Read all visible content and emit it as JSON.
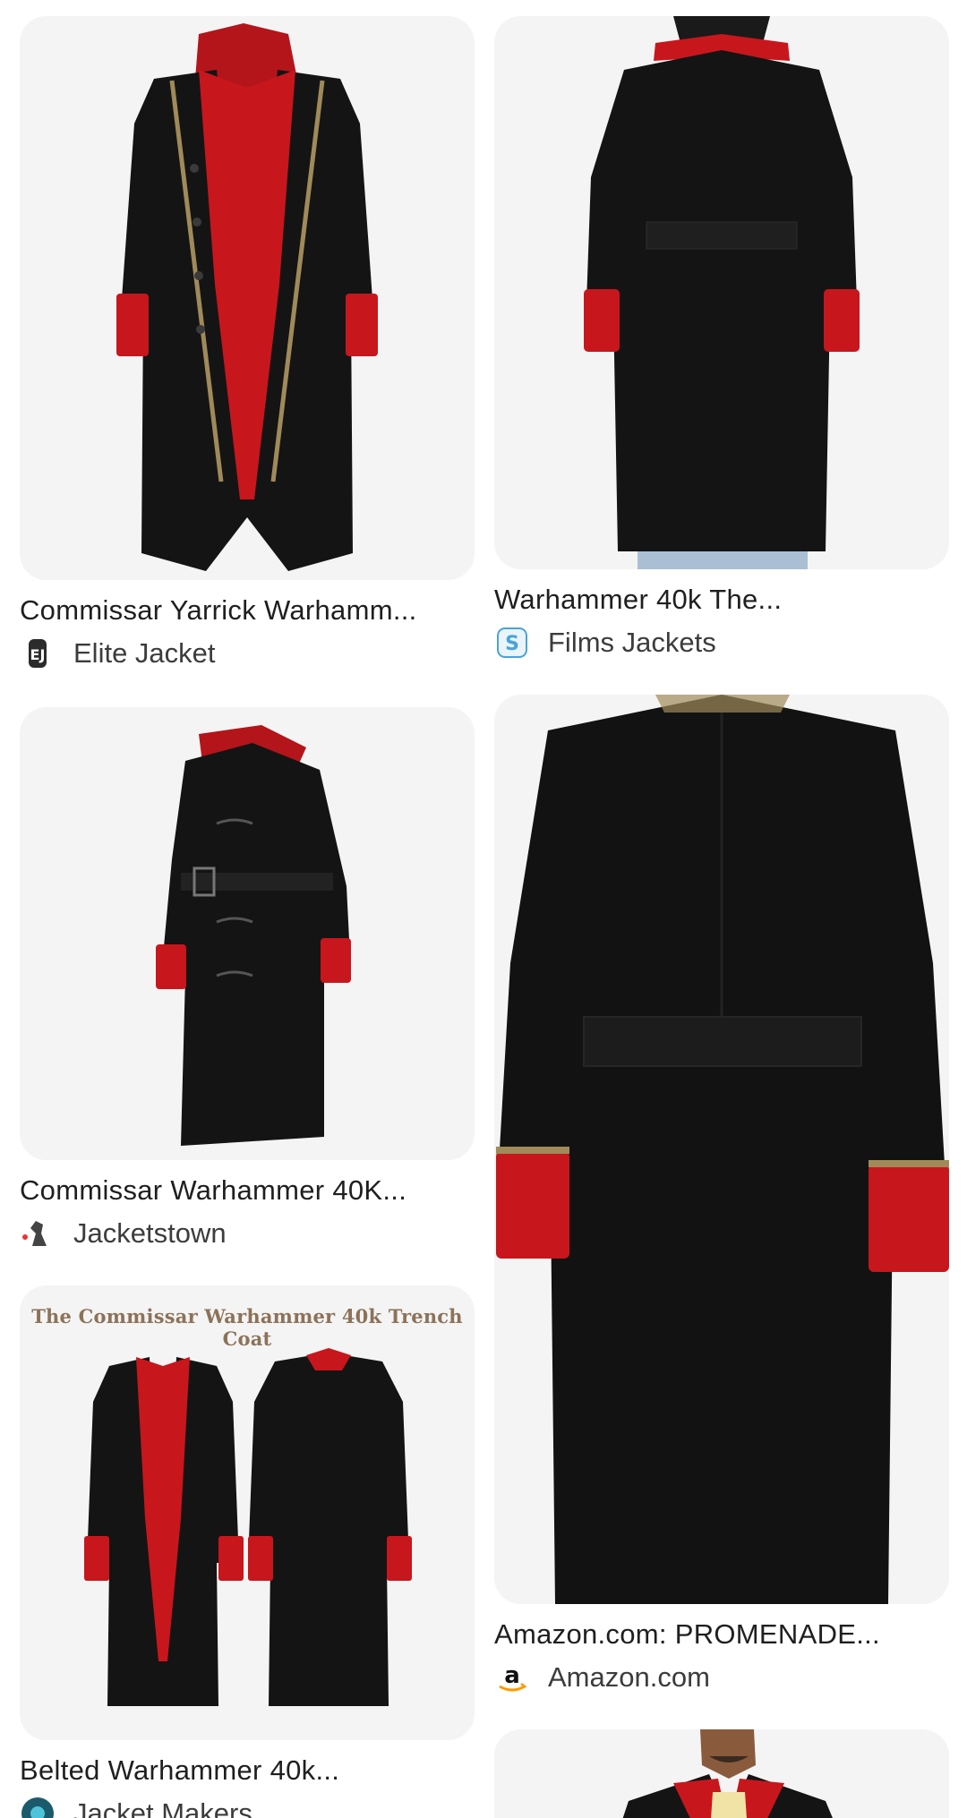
{
  "results": [
    {
      "title": "Commissar Yarrick Warhamm...",
      "source": "Elite Jacket",
      "image": "black-red-trench-coat-front"
    },
    {
      "title": "Warhammer 40k The...",
      "source": "Films Jackets",
      "image": "black-red-trench-coat-back-model"
    },
    {
      "title": "Commissar Warhammer 40K...",
      "source": "Jacketstown",
      "image": "black-belted-trench-coat-side"
    },
    {
      "title": "Amazon.com: PROMENADE...",
      "source": "Amazon.com",
      "image": "black-trench-coat-back-closeup"
    },
    {
      "title": "Belted Warhammer 40k...",
      "source": "Jacket Makers",
      "image": "trench-coat-front-and-back",
      "banner": "The Commissar Warhammer 40k Trench Coat"
    },
    {
      "title": "",
      "source": "",
      "image": "model-wearing-trench-coat"
    }
  ],
  "colors": {
    "coat": "#141414",
    "lining": "#c8161d",
    "trim": "#a08a5a",
    "card_bg": "#f4f4f4",
    "amazon_orange": "#f90"
  }
}
